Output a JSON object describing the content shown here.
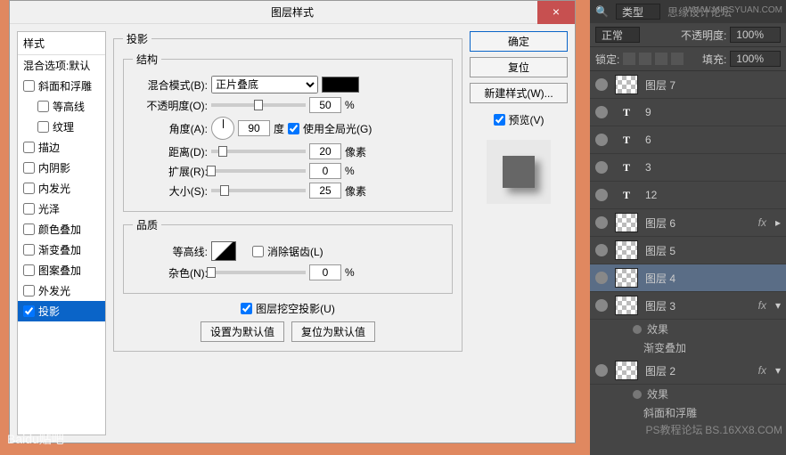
{
  "dialog": {
    "title": "图层样式",
    "close": "×",
    "styles_header": "样式",
    "blend_defaults": "混合选项:默认",
    "style_items": [
      {
        "label": "斜面和浮雕",
        "checked": false
      },
      {
        "label": "等高线",
        "checked": false,
        "indent": true
      },
      {
        "label": "纹理",
        "checked": false,
        "indent": true
      },
      {
        "label": "描边",
        "checked": false
      },
      {
        "label": "内阴影",
        "checked": false
      },
      {
        "label": "内发光",
        "checked": false
      },
      {
        "label": "光泽",
        "checked": false
      },
      {
        "label": "颜色叠加",
        "checked": false
      },
      {
        "label": "渐变叠加",
        "checked": false
      },
      {
        "label": "图案叠加",
        "checked": false
      },
      {
        "label": "外发光",
        "checked": false
      },
      {
        "label": "投影",
        "checked": true,
        "selected": true
      }
    ],
    "shadow": {
      "section_title": "投影",
      "structure_legend": "结构",
      "blend_mode_label": "混合模式(B):",
      "blend_mode_value": "正片叠底",
      "opacity_label": "不透明度(O):",
      "opacity_value": "50",
      "percent": "%",
      "angle_label": "角度(A):",
      "angle_value": "90",
      "degree": "度",
      "global_light_label": "使用全局光(G)",
      "global_light_checked": true,
      "distance_label": "距离(D):",
      "distance_value": "20",
      "px": "像素",
      "spread_label": "扩展(R):",
      "spread_value": "0",
      "size_label": "大小(S):",
      "size_value": "25",
      "quality_legend": "品质",
      "contour_label": "等高线:",
      "antialias_label": "消除锯齿(L)",
      "noise_label": "杂色(N):",
      "noise_value": "0",
      "knockout_label": "图层挖空投影(U)",
      "knockout_checked": true,
      "reset_default": "设置为默认值",
      "revert_default": "复位为默认值"
    },
    "right": {
      "ok": "确定",
      "cancel": "复位",
      "new_style": "新建样式(W)...",
      "preview_label": "预览(V)",
      "preview_checked": true
    }
  },
  "layers_panel": {
    "tab_type": "类型",
    "search_hint": "思缘设计论坛",
    "watermark": "WWW.MISSYUAN.COM",
    "blend_mode": "正常",
    "opacity_label": "不透明度:",
    "opacity_value": "100%",
    "lock_label": "锁定:",
    "fill_label": "填充:",
    "fill_value": "100%",
    "fx_label": "fx",
    "effects_label": "效果",
    "bevel_label": "斜面和浮雕",
    "gradient_overlay_label": "渐变叠加",
    "layers": [
      {
        "name": "图层 7",
        "type": "pixel"
      },
      {
        "name": "9",
        "type": "text"
      },
      {
        "name": "6",
        "type": "text"
      },
      {
        "name": "3",
        "type": "text"
      },
      {
        "name": "12",
        "type": "text"
      },
      {
        "name": "图层 6",
        "type": "pixel",
        "fx": true
      },
      {
        "name": "图层 5",
        "type": "pixel"
      },
      {
        "name": "图层 4",
        "type": "pixel",
        "selected": true
      },
      {
        "name": "图层 3",
        "type": "pixel",
        "fx": true,
        "expanded": true,
        "effects": [
          "gradient"
        ]
      },
      {
        "name": "图层 2",
        "type": "pixel",
        "fx": true,
        "expanded": true,
        "effects": [
          "bevel"
        ]
      }
    ],
    "footer_wm": "PS教程论坛",
    "footer_wm2": "BS.16XX8.COM"
  },
  "bottom_watermark": "Baidu贴吧"
}
